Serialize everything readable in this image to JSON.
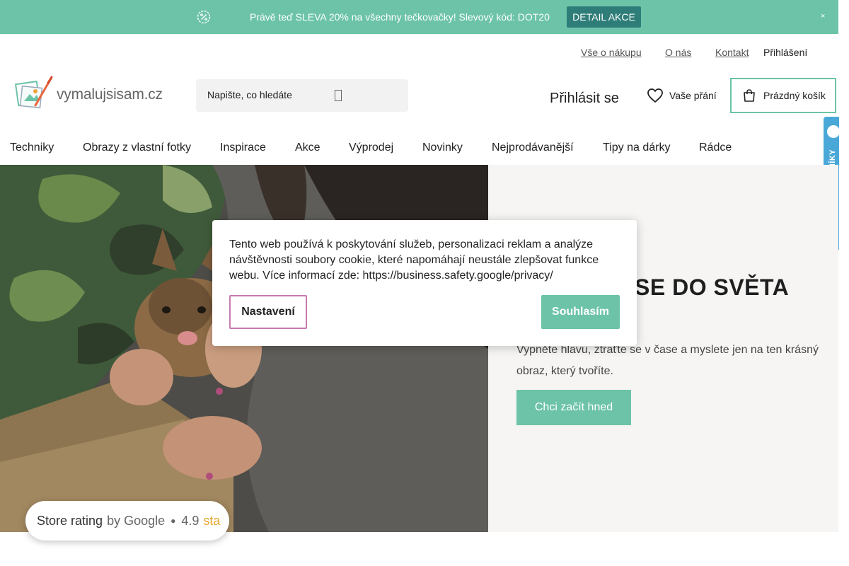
{
  "promo": {
    "text": "Právě teď SLEVA 20% na všechny tečkovačky! Slevový kód: DOT20",
    "button": "DETAIL AKCE",
    "close": "×"
  },
  "toplinks": {
    "about_shopping": "Vše o nákupu",
    "about_us": "O nás",
    "contact": "Kontakt",
    "login": "Přihlášení"
  },
  "header": {
    "logo_text": "vymalujsisam.cz",
    "search_placeholder": "Napište, co hledáte",
    "signin": "Přihlásit se",
    "wishlist": "Vaše přání",
    "cart": "Prázdný košík"
  },
  "nav": {
    "items": [
      "Techniky",
      "Obrazy z vlastní fotky",
      "Inspirace",
      "Akce",
      "Výprodej",
      "Novinky",
      "Nejprodávanější",
      "Tipy na dárky",
      "Rádce"
    ]
  },
  "badge": {
    "text": "OVĚŘENO ZÁKAZNÍKY"
  },
  "hero": {
    "title": "SE DO SVĚTA",
    "subtitle": "Vypněte hlavu, ztraťte se v čase a myslete jen na ten krásný obraz, který tvoříte.",
    "cta": "Chci začít hned"
  },
  "cookie": {
    "text": "Tento web používá k poskytování služeb, personalizaci reklam a analýze návštěvnosti soubory cookie, které napomáhají neustále zlepšovat funkce webu. Více informací zde: https://business.safety.google/privacy/",
    "settings": "Nastavení",
    "accept": "Souhlasím"
  },
  "rating": {
    "store": "Store rating",
    "by": "by Google",
    "score": "4.9",
    "stars": "sta"
  },
  "colors": {
    "accent": "#6cc3a8",
    "dark_accent": "#2f7d78",
    "settings_border": "#c77ab0",
    "badge": "#4aa8d8"
  }
}
